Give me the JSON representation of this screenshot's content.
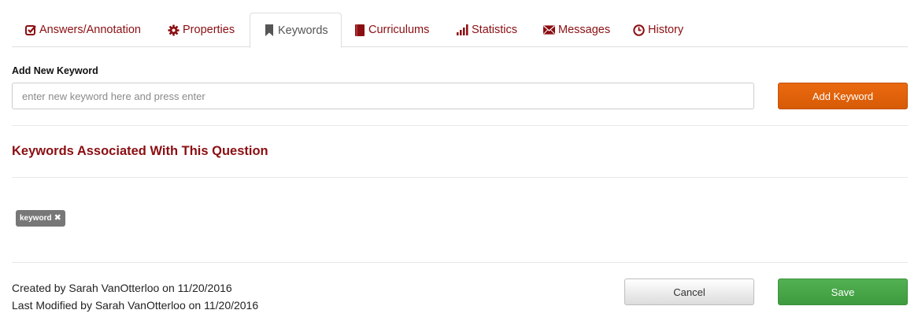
{
  "tabs": [
    {
      "label": "Answers/Annotation",
      "icon": "check-square-icon"
    },
    {
      "label": "Properties",
      "icon": "gear-icon"
    },
    {
      "label": "Keywords",
      "icon": "bookmark-icon",
      "active": true
    },
    {
      "label": "Curriculums",
      "icon": "book-icon"
    },
    {
      "label": "Statistics",
      "icon": "signal-bars-icon"
    },
    {
      "label": "Messages",
      "icon": "envelope-icon"
    },
    {
      "label": "History",
      "icon": "clock-icon"
    }
  ],
  "add_keyword": {
    "label": "Add New Keyword",
    "placeholder": "enter new keyword here and press enter",
    "value": "",
    "button_label": "Add Keyword"
  },
  "associated": {
    "title": "Keywords Associated With This Question",
    "tags": [
      {
        "label": "keyword",
        "remove_icon": "close-icon"
      }
    ]
  },
  "footer": {
    "created": "Created by Sarah VanOtterloo on 11/20/2016",
    "modified": "Last Modified by Sarah VanOtterloo on 11/20/2016",
    "cancel_label": "Cancel",
    "save_label": "Save"
  },
  "colors": {
    "brand": "#8b0e12",
    "accent_orange": "#e2630b",
    "save_green": "#48a648",
    "tag_gray": "#777777"
  }
}
